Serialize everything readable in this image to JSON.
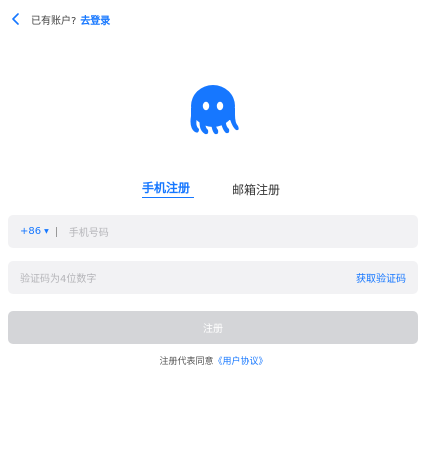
{
  "header": {
    "has_account_text": "已有账户?",
    "login_link": "去登录"
  },
  "tabs": {
    "phone_tab": "手机注册",
    "email_tab": "邮箱注册"
  },
  "phone_field": {
    "country_code": "+86",
    "placeholder": "手机号码"
  },
  "code_field": {
    "placeholder": "验证码为4位数字",
    "get_code_label": "获取验证码"
  },
  "submit": {
    "label": "注册"
  },
  "agreement": {
    "text": "注册代表同意",
    "link": "《用户协议》"
  },
  "colors": {
    "accent": "#1677ff",
    "field_bg": "#f2f2f4",
    "disabled_button": "#d4d5d8"
  },
  "icons": {
    "back": "chevron-left-icon",
    "logo": "octopus-logo"
  }
}
